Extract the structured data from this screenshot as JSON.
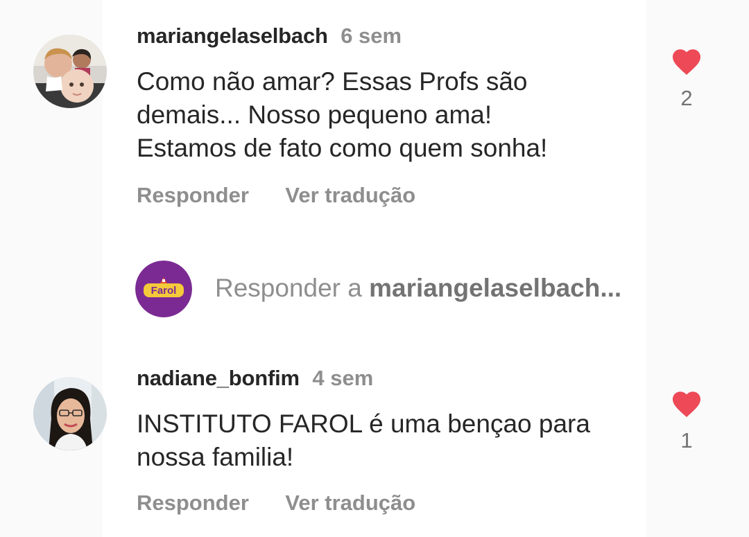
{
  "comments": [
    {
      "username": "mariangelaselbach",
      "time": "6 sem",
      "lines": [
        "Como não amar? Essas Profs são",
        "demais... Nosso pequeno ama!",
        "Estamos de fato como quem sonha!"
      ],
      "likes": "2",
      "reply_label": "Responder",
      "translate_label": "Ver tradução",
      "avatar_icon": "family-photo-avatar",
      "like_icon": "heart-filled-icon"
    },
    {
      "username": "nadiane_bonfim",
      "time": "4 sem",
      "lines": [
        "INSTITUTO FAROL é uma bençao para",
        "nossa familia!"
      ],
      "likes": "1",
      "reply_label": "Responder",
      "translate_label": "Ver tradução",
      "avatar_icon": "woman-photo-avatar",
      "like_icon": "heart-filled-icon"
    }
  ],
  "reply_box": {
    "prefix": "Responder a ",
    "target": "mariangelaselbach...",
    "avatar_logo_text": "Farol",
    "avatar_icon": "farol-logo-avatar"
  },
  "colors": {
    "heart": "#ed4956",
    "muted_text": "#8e8e8e",
    "primary_text": "#262626",
    "farol_purple": "#7b2a93"
  }
}
